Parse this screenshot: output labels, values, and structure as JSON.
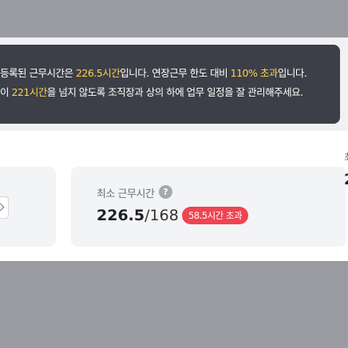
{
  "banner": {
    "line1_prefix": "등록된 근무시간은 ",
    "line1_hours": "226.5시간",
    "line1_mid": "입니다. 연장근무 한도 대비 ",
    "line1_pct": "110% 초과",
    "line1_suffix": "입니다.",
    "line2_prefix": "이 ",
    "line2_limit": "221시간",
    "line2_suffix": "을 넘지 않도록 조직장과 상의 하에 업무 일정을 잘 관리해주세요."
  },
  "min_hours_card": {
    "title": "최소 근무시간",
    "help_icon": "?",
    "value": "226.5",
    "target": "/168",
    "badge": "58.5시간 초과"
  },
  "right_card_peek": {
    "title": "최",
    "value": "2"
  },
  "colors": {
    "banner_bg": "#3c3f47",
    "highlight": "#ffd24a",
    "badge_red": "#ef4452"
  }
}
